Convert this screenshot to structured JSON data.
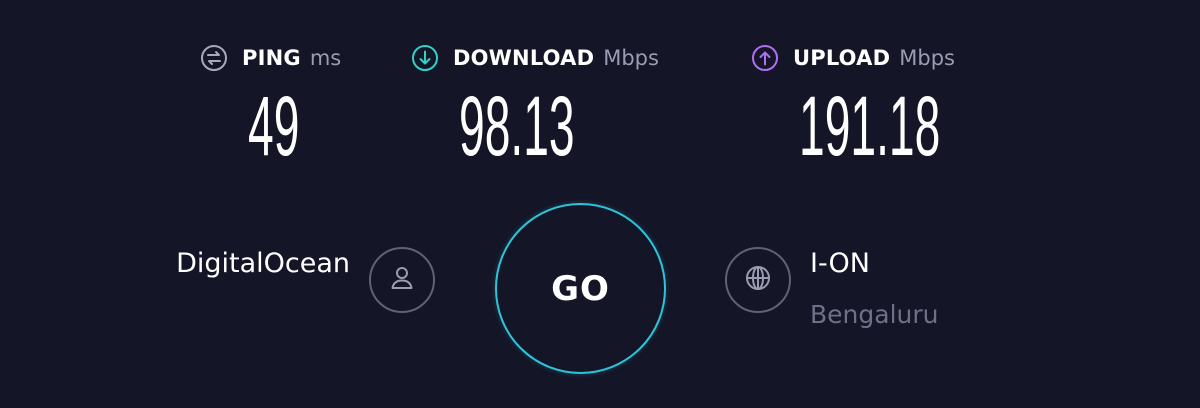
{
  "metrics": {
    "ping": {
      "label": "PING",
      "unit": "ms",
      "value": "49",
      "icon": "ping-icon"
    },
    "download": {
      "label": "DOWNLOAD",
      "unit": "Mbps",
      "value": "98.13",
      "icon": "download-arrow-icon"
    },
    "upload": {
      "label": "UPLOAD",
      "unit": "Mbps",
      "value": "191.18",
      "icon": "upload-arrow-icon"
    }
  },
  "host": {
    "name": "DigitalOcean",
    "icon": "user-icon"
  },
  "go_button": {
    "label": "GO"
  },
  "isp": {
    "name": "I-ON",
    "location": "Bengaluru",
    "icon": "globe-icon"
  },
  "colors": {
    "background": "#141526",
    "download_accent": "#2fd1c8",
    "upload_accent": "#b06ff0",
    "ping_icon": "#a8aabb",
    "go_ring": "#2fc3d8",
    "muted_text": "#6e7087"
  }
}
